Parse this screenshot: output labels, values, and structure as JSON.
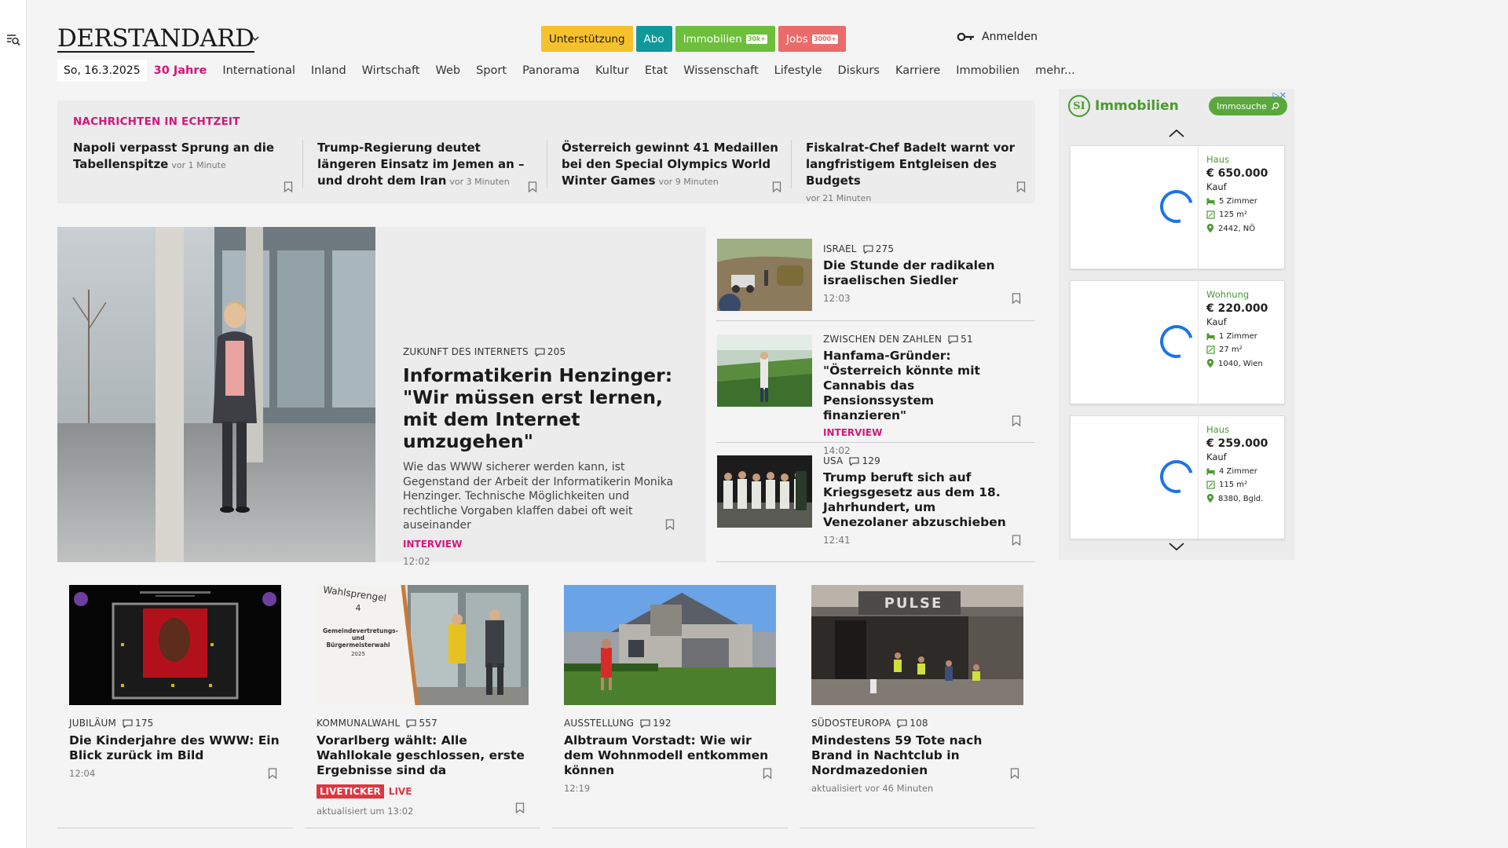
{
  "brand": {
    "logo": "DERSTANDARD"
  },
  "top_buttons": {
    "support": "Unterstützung",
    "abo": "Abo",
    "immobilien": "Immobilien",
    "immobilien_badge": "30k+",
    "jobs": "Jobs",
    "jobs_badge": "3000+"
  },
  "login": {
    "label": "Anmelden"
  },
  "nav": {
    "date": "So, 16.3.2025",
    "items": [
      "30 Jahre",
      "International",
      "Inland",
      "Wirtschaft",
      "Web",
      "Sport",
      "Panorama",
      "Kultur",
      "Etat",
      "Wissenschaft",
      "Lifestyle",
      "Diskurs",
      "Karriere",
      "Immobilien",
      "mehr..."
    ]
  },
  "ticker": {
    "heading": "NACHRICHTEN IN ECHTZEIT",
    "items": [
      {
        "title": "Napoli verpasst Sprung an die Tabellenspitze",
        "time": "vor 1 Minute"
      },
      {
        "title": "Trump-Regierung deutet längeren Einsatz im Jemen an – und droht dem Iran",
        "time": "vor 3 Minuten"
      },
      {
        "title": "Österreich gewinnt 41 Medaillen bei den Special Olympics World Winter Games",
        "time": "vor 9 Minuten"
      },
      {
        "title": "Fiskalrat-Chef Badelt warnt vor langfristigem Entgleisen des Budgets",
        "time": "vor 21 Minuten"
      }
    ]
  },
  "hero": {
    "kicker": "ZUKUNFT DES INTERNETS",
    "comments": "205",
    "title": "Informatikerin Henzinger: \"Wir müssen erst lernen, mit dem Internet umzugehen\"",
    "teaser": "Wie das WWW sicherer werden kann, ist Gegenstand der Arbeit der Informatikerin Monika Henzinger. Technische Möglichkeiten und rechtliche Vorgaben klaffen dabei oft weit auseinander",
    "tag": "INTERVIEW",
    "time": "12:02"
  },
  "side": [
    {
      "kicker": "ISRAEL",
      "comments": "275",
      "title": "Die Stunde der radikalen israelischen Siedler",
      "tag": "",
      "time": "12:03"
    },
    {
      "kicker": "ZWISCHEN DEN ZAHLEN",
      "comments": "51",
      "title": "Hanfama-Gründer: \"Österreich könnte mit Cannabis das Pensionssystem finanzieren\"",
      "tag": "INTERVIEW",
      "time": "14:02"
    },
    {
      "kicker": "USA",
      "comments": "129",
      "title": "Trump beruft sich auf Kriegsgesetz aus dem 18. Jahrhundert, um Venezolaner abzuschieben",
      "tag": "",
      "time": "12:41"
    }
  ],
  "bottom": [
    {
      "kicker": "JUBILÄUM",
      "comments": "175",
      "title": "Die Kinderjahre des WWW: Ein Blick zurück im Bild",
      "time": "12:04"
    },
    {
      "kicker": "KOMMUNALWAHL",
      "comments": "557",
      "title": "Vorarlberg wählt: Alle Wahllokale geschlossen, erste Ergebnisse sind da",
      "live_tag": "LIVETICKER",
      "live": "LIVE",
      "time": "aktualisiert um 13:02"
    },
    {
      "kicker": "AUSSTELLUNG",
      "comments": "192",
      "title": "Albtraum Vorstadt: Wie wir dem Wohnmodell entkommen können",
      "time": "12:19"
    },
    {
      "kicker": "SÜDOSTEUROPA",
      "comments": "108",
      "title": "Mindestens 59 Tote nach Brand in Nachtclub in Nordmazedonien",
      "time": "aktualisiert vor 46 Minuten"
    }
  ],
  "bottom_images": {
    "wahl_sign_1": "Wahlsprengel",
    "wahl_sign_2": "4",
    "wahl_sign_3": "Gemeindevertretungs- und Bürgermeisterwahl",
    "wahl_sign_4": "2025",
    "club_sign": "PULSE"
  },
  "ad": {
    "brand": "Immobilien",
    "brand_mark": "SI",
    "search_button": "Immosuche",
    "cards": [
      {
        "type": "Haus",
        "price": "€ 650.000",
        "deal": "Kauf",
        "rooms": "5 Zimmer",
        "area": "125 m²",
        "location": "2442, NÖ"
      },
      {
        "type": "Wohnung",
        "price": "€ 220.000",
        "deal": "Kauf",
        "rooms": "1 Zimmer",
        "area": "27 m²",
        "location": "1040, Wien"
      },
      {
        "type": "Haus",
        "price": "€ 259.000",
        "deal": "Kauf",
        "rooms": "4 Zimmer",
        "area": "115 m²",
        "location": "8380, Bgld."
      }
    ]
  },
  "colors": {
    "accent": "#d2177a",
    "ad_green": "#4a9a2f",
    "live_red": "#e0363f"
  }
}
